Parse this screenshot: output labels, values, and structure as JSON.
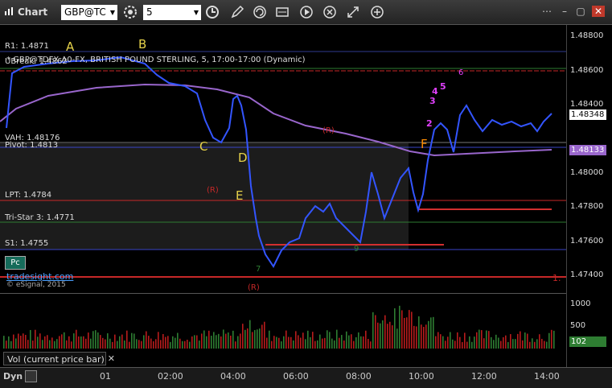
{
  "window": {
    "title": "Chart"
  },
  "toolbar": {
    "symbol": "GBP@TC",
    "interval": "5"
  },
  "chart": {
    "header": "* GBP@TDFX A0-FX, BRITISH POUND STERLING, 5, 17:00-17:00 (Dynamic)",
    "levels": {
      "r1": "R1: 1.4871",
      "ubreak": "UBreak: 1.4862",
      "vah": "VAH: 1.48176",
      "pivot": "Pivot: 1.4813",
      "lpt": "LPT: 1.4784",
      "tristar": "Tri-Star 3: 1.4771",
      "s1": "S1: 1.4755"
    },
    "price_ticks": [
      "1.48800",
      "1.48600",
      "1.48400",
      "1.48200",
      "1.48000",
      "1.47800",
      "1.47600",
      "1.47400"
    ],
    "last_price": "1.48348",
    "ma_price": "1.48133",
    "letters": [
      "A",
      "B",
      "C",
      "D",
      "E",
      "F"
    ],
    "markers": [
      "(R)",
      "(R)",
      "(R)",
      "1."
    ],
    "counts": [
      "1",
      "2",
      "3",
      "4",
      "5",
      "6",
      "7",
      "8",
      "9"
    ],
    "pc_label": "Pc",
    "brand": "tradesight.com",
    "copyright": "© eSignal, 2015"
  },
  "volume": {
    "label": "Vol (current price bar)",
    "ticks": [
      "1000",
      "500"
    ],
    "last": "102"
  },
  "time_axis": {
    "dyn": "Dyn",
    "labels": [
      "01",
      "02:00",
      "04:00",
      "06:00",
      "08:00",
      "10:00",
      "12:00",
      "14:00"
    ]
  },
  "colors": {
    "background": "#000000",
    "price_bar": "#3355ff",
    "up_bar": "#ffffff",
    "ma": "#9966cc",
    "r1_line": "#2f3a8f",
    "ubreak_line": "#2e7d32",
    "pivot_line": "#3a44c8",
    "lpt_line": "#c62828",
    "tristar_line": "#2e7d32",
    "s1_line": "#3a44c8",
    "last_price_tag": "#ffffff",
    "ma_tag": "#9966cc",
    "vol_tag": "#2e7d32"
  }
}
